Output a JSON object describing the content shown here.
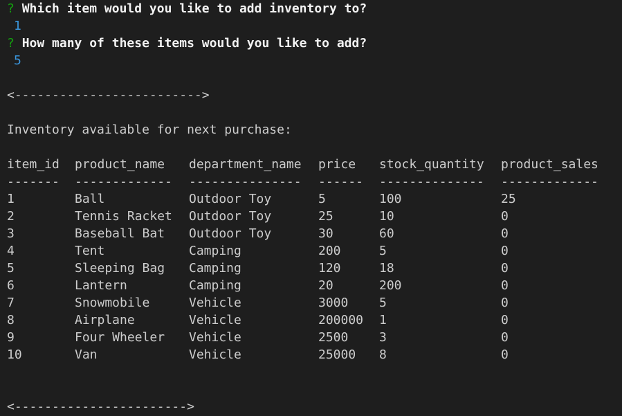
{
  "prompt1": {
    "mark": "?",
    "question": "Which item would you like to add inventory to?",
    "answer": "1"
  },
  "prompt2": {
    "mark": "?",
    "question": "How many of these items would you like to add?",
    "answer": "5"
  },
  "separator_top": "<------------------------->",
  "heading": "Inventory available for next purchase:",
  "table": {
    "headers": [
      "item_id",
      "product_name",
      "department_name",
      "price",
      "stock_quantity",
      "product_sales"
    ],
    "dashes": [
      "-------",
      "-------------",
      "---------------",
      "------",
      "--------------",
      "-------------"
    ],
    "rows": [
      [
        "1",
        "Ball",
        "Outdoor Toy",
        "5",
        "100",
        "25"
      ],
      [
        "2",
        "Tennis Racket",
        "Outdoor Toy",
        "25",
        "10",
        "0"
      ],
      [
        "3",
        "Baseball Bat",
        "Outdoor Toy",
        "30",
        "60",
        "0"
      ],
      [
        "4",
        "Tent",
        "Camping",
        "200",
        "5",
        "0"
      ],
      [
        "5",
        "Sleeping Bag",
        "Camping",
        "120",
        "18",
        "0"
      ],
      [
        "6",
        "Lantern",
        "Camping",
        "20",
        "200",
        "0"
      ],
      [
        "7",
        "Snowmobile",
        "Vehicle",
        "3000",
        "5",
        "0"
      ],
      [
        "8",
        "Airplane",
        "Vehicle",
        "200000",
        "1",
        "0"
      ],
      [
        "9",
        "Four Wheeler",
        "Vehicle",
        "2500",
        "3",
        "0"
      ],
      [
        "10",
        "Van",
        "Vehicle",
        "25000",
        "8",
        "0"
      ]
    ]
  },
  "separator_bottom": "<----------------------->",
  "colors": {
    "background": "#1e1e1e",
    "text": "#cccccc",
    "prompt_mark": "#13a10e",
    "answer": "#3a96dd"
  }
}
